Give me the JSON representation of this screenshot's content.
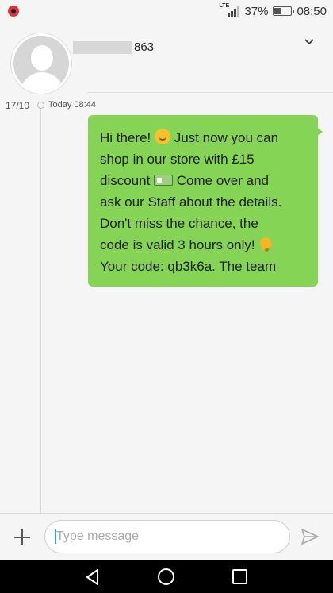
{
  "status_bar": {
    "network_type": "LTE",
    "battery_percent": "37%",
    "battery_level": 0.37,
    "time": "08:50",
    "icons": [
      "app-notification-icon",
      "signal-icon",
      "battery-icon"
    ]
  },
  "conversation": {
    "contact_number_suffix": "863",
    "date_label": "17/10",
    "time_label": "Today 08:44",
    "icons": [
      "avatar-placeholder-icon",
      "chevron-down-icon"
    ]
  },
  "message": {
    "line1a": "Hi there! ",
    "line1b": " Just now you can",
    "line2": "shop in our store with £15",
    "line3a": "discount ",
    "line3b": " Come over and",
    "line4": "ask our Staff about the details.",
    "line5": "Don't miss the chance, the",
    "line6a": "code is valid 3 hours only! ",
    "line7": "Your code: qb3k6a. The team",
    "emojis": [
      "smiling-face-emoji",
      "pound-banknote-emoji",
      "bell-emoji"
    ],
    "bubble_color": "#86d455"
  },
  "composer": {
    "placeholder": "Type message",
    "icons": [
      "plus-icon",
      "send-icon"
    ]
  },
  "nav_bar": {
    "icons": [
      "back-icon",
      "home-icon",
      "recent-apps-icon"
    ]
  }
}
